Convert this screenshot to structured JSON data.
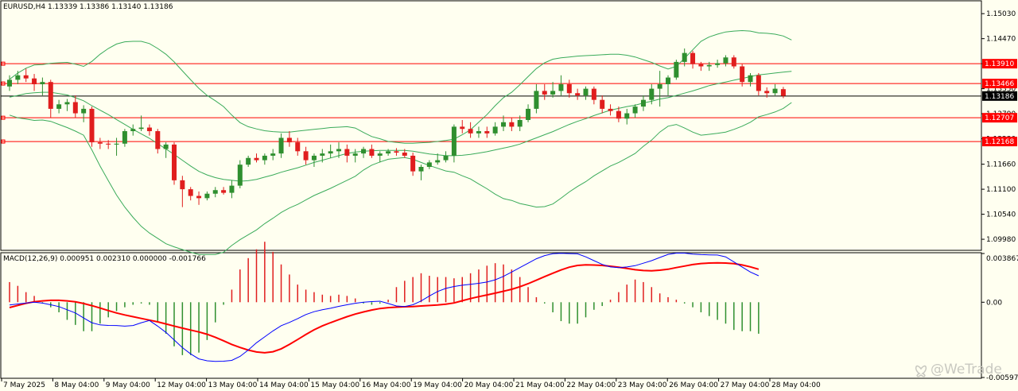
{
  "chart_data": {
    "type": "candlestick",
    "symbol_header": "EURUSD,H4  1.13339 1.13386 1.13140 1.13186",
    "price_axis": {
      "ylim": [
        1.0975,
        1.153
      ],
      "ticks": [
        "1.15030",
        "1.14470",
        "1.13910",
        "1.13350",
        "1.12790",
        "1.12230",
        "1.11660",
        "1.11100",
        "1.10540",
        "1.09980"
      ]
    },
    "horizontal_lines": [
      {
        "value": 1.1391,
        "label": "1.13910",
        "color": "#ff0000"
      },
      {
        "value": 1.13466,
        "label": "1.13466",
        "color": "#ff0000"
      },
      {
        "value": 1.127,
        "label": "1.12707",
        "color": "#ff0000"
      },
      {
        "value": 1.12168,
        "label": "1.12168",
        "color": "#ff0000"
      },
      {
        "value": 1.13186,
        "label": "1.13186",
        "color": "#000000"
      }
    ],
    "time_axis_labels": [
      "7 May 2025",
      "8 May 04:00",
      "9 May 04:00",
      "12 May 04:00",
      "13 May 04:00",
      "14 May 04:00",
      "15 May 04:00",
      "16 May 04:00",
      "19 May 04:00",
      "20 May 04:00",
      "21 May 04:00",
      "22 May 04:00",
      "23 May 04:00",
      "26 May 04:00",
      "27 May 04:00",
      "28 May 04:00"
    ],
    "candles": [
      [
        1.134,
        1.1365,
        1.133,
        1.1355
      ],
      [
        1.1355,
        1.1375,
        1.1345,
        1.1365
      ],
      [
        1.1365,
        1.138,
        1.135,
        1.1358
      ],
      [
        1.1358,
        1.1368,
        1.133,
        1.1345
      ],
      [
        1.1345,
        1.136,
        1.132,
        1.135
      ],
      [
        1.135,
        1.1355,
        1.127,
        1.129
      ],
      [
        1.129,
        1.131,
        1.128,
        1.13
      ],
      [
        1.13,
        1.1312,
        1.1285,
        1.1305
      ],
      [
        1.1305,
        1.132,
        1.127,
        1.128
      ],
      [
        1.128,
        1.1298,
        1.126,
        1.129
      ],
      [
        1.129,
        1.1295,
        1.1205,
        1.1215
      ],
      [
        1.1215,
        1.1225,
        1.12,
        1.1212
      ],
      [
        1.1212,
        1.122,
        1.12,
        1.121
      ],
      [
        1.121,
        1.1225,
        1.1185,
        1.1212
      ],
      [
        1.1212,
        1.1245,
        1.1205,
        1.124
      ],
      [
        1.124,
        1.1255,
        1.123,
        1.1245
      ],
      [
        1.1245,
        1.1275,
        1.124,
        1.1248
      ],
      [
        1.1248,
        1.1255,
        1.123,
        1.124
      ],
      [
        1.124,
        1.1245,
        1.119,
        1.12
      ],
      [
        1.12,
        1.1215,
        1.118,
        1.121
      ],
      [
        1.121,
        1.1215,
        1.112,
        1.113
      ],
      [
        1.113,
        1.114,
        1.107,
        1.111
      ],
      [
        1.111,
        1.1115,
        1.1085,
        1.1095
      ],
      [
        1.1095,
        1.1105,
        1.1075,
        1.109
      ],
      [
        1.109,
        1.1105,
        1.1085,
        1.11
      ],
      [
        1.11,
        1.1115,
        1.1092,
        1.1108
      ],
      [
        1.1108,
        1.1115,
        1.1098,
        1.1102
      ],
      [
        1.1102,
        1.113,
        1.109,
        1.1118
      ],
      [
        1.1118,
        1.1175,
        1.1112,
        1.1165
      ],
      [
        1.1165,
        1.1185,
        1.116,
        1.118
      ],
      [
        1.118,
        1.119,
        1.117,
        1.1175
      ],
      [
        1.1175,
        1.119,
        1.1165,
        1.1185
      ],
      [
        1.1185,
        1.12,
        1.1175,
        1.119
      ],
      [
        1.119,
        1.1235,
        1.118,
        1.1225
      ],
      [
        1.1225,
        1.124,
        1.1205,
        1.1215
      ],
      [
        1.1215,
        1.1225,
        1.1185,
        1.1195
      ],
      [
        1.1195,
        1.1205,
        1.1165,
        1.1175
      ],
      [
        1.1175,
        1.119,
        1.116,
        1.1185
      ],
      [
        1.1185,
        1.12,
        1.117,
        1.119
      ],
      [
        1.119,
        1.121,
        1.118,
        1.1195
      ],
      [
        1.1195,
        1.1215,
        1.118,
        1.12
      ],
      [
        1.12,
        1.121,
        1.117,
        1.1185
      ],
      [
        1.1185,
        1.12,
        1.117,
        1.119
      ],
      [
        1.119,
        1.1205,
        1.118,
        1.12
      ],
      [
        1.12,
        1.121,
        1.118,
        1.1185
      ],
      [
        1.1185,
        1.1195,
        1.117,
        1.119
      ],
      [
        1.119,
        1.12,
        1.1185,
        1.1195
      ],
      [
        1.1195,
        1.1202,
        1.1185,
        1.1192
      ],
      [
        1.1192,
        1.12,
        1.118,
        1.1185
      ],
      [
        1.1185,
        1.1192,
        1.114,
        1.115
      ],
      [
        1.115,
        1.1165,
        1.113,
        1.116
      ],
      [
        1.116,
        1.1175,
        1.1155,
        1.117
      ],
      [
        1.117,
        1.119,
        1.1165,
        1.1175
      ],
      [
        1.1175,
        1.1195,
        1.117,
        1.1185
      ],
      [
        1.1185,
        1.1255,
        1.117,
        1.125
      ],
      [
        1.125,
        1.1265,
        1.1235,
        1.1245
      ],
      [
        1.1245,
        1.126,
        1.1225,
        1.1235
      ],
      [
        1.1235,
        1.125,
        1.1225,
        1.124
      ],
      [
        1.124,
        1.125,
        1.1225,
        1.1235
      ],
      [
        1.1235,
        1.126,
        1.123,
        1.125
      ],
      [
        1.125,
        1.1275,
        1.124,
        1.126
      ],
      [
        1.126,
        1.127,
        1.124,
        1.125
      ],
      [
        1.125,
        1.1275,
        1.124,
        1.1265
      ],
      [
        1.1265,
        1.13,
        1.126,
        1.129
      ],
      [
        1.129,
        1.1345,
        1.128,
        1.133
      ],
      [
        1.133,
        1.1345,
        1.131,
        1.1322
      ],
      [
        1.1322,
        1.135,
        1.1315,
        1.133
      ],
      [
        1.133,
        1.1365,
        1.132,
        1.1345
      ],
      [
        1.1345,
        1.1355,
        1.1315,
        1.1325
      ],
      [
        1.1325,
        1.1335,
        1.131,
        1.132
      ],
      [
        1.132,
        1.134,
        1.131,
        1.1335
      ],
      [
        1.1335,
        1.134,
        1.13,
        1.131
      ],
      [
        1.131,
        1.132,
        1.128,
        1.129
      ],
      [
        1.129,
        1.13,
        1.1275,
        1.1285
      ],
      [
        1.1285,
        1.1295,
        1.126,
        1.1268
      ],
      [
        1.1268,
        1.129,
        1.1255,
        1.128
      ],
      [
        1.128,
        1.13,
        1.127,
        1.1295
      ],
      [
        1.1295,
        1.132,
        1.1285,
        1.131
      ],
      [
        1.131,
        1.1345,
        1.13,
        1.1335
      ],
      [
        1.1335,
        1.1375,
        1.1295,
        1.1345
      ],
      [
        1.1345,
        1.1365,
        1.132,
        1.136
      ],
      [
        1.136,
        1.14,
        1.1355,
        1.1395
      ],
      [
        1.1395,
        1.1425,
        1.1385,
        1.1415
      ],
      [
        1.1415,
        1.142,
        1.138,
        1.139
      ],
      [
        1.139,
        1.1395,
        1.1375,
        1.1385
      ],
      [
        1.1385,
        1.1395,
        1.1375,
        1.1388
      ],
      [
        1.1388,
        1.14,
        1.1382,
        1.1392
      ],
      [
        1.1392,
        1.141,
        1.1385,
        1.1405
      ],
      [
        1.1405,
        1.141,
        1.138,
        1.1385
      ],
      [
        1.1385,
        1.139,
        1.134,
        1.135
      ],
      [
        1.135,
        1.137,
        1.134,
        1.1365
      ],
      [
        1.1365,
        1.137,
        1.132,
        1.133
      ],
      [
        1.133,
        1.1338,
        1.1315,
        1.1325
      ],
      [
        1.1325,
        1.1345,
        1.132,
        1.1335
      ],
      [
        1.1334,
        1.1339,
        1.1314,
        1.1319
      ]
    ],
    "bollinger": {
      "upper": [
        1.1356,
        1.137,
        1.1381,
        1.1388,
        1.1389,
        1.1392,
        1.1393,
        1.1394,
        1.139,
        1.1385,
        1.1396,
        1.1412,
        1.1425,
        1.1435,
        1.144,
        1.1441,
        1.1441,
        1.1436,
        1.1425,
        1.1412,
        1.1395,
        1.1375,
        1.1355,
        1.1336,
        1.132,
        1.1308,
        1.1295,
        1.1276,
        1.1259,
        1.125,
        1.1245,
        1.1241,
        1.1239,
        1.1238,
        1.1238,
        1.124,
        1.1242,
        1.1244,
        1.1246,
        1.1248,
        1.1249,
        1.125,
        1.1247,
        1.1237,
        1.1228,
        1.1223,
        1.1217,
        1.1215,
        1.1213,
        1.1213,
        1.1214,
        1.1215,
        1.1217,
        1.1219,
        1.1222,
        1.1232,
        1.1243,
        1.126,
        1.1277,
        1.1297,
        1.1315,
        1.1327,
        1.1344,
        1.1362,
        1.138,
        1.1393,
        1.1401,
        1.1404,
        1.1406,
        1.1408,
        1.1409,
        1.141,
        1.1411,
        1.1412,
        1.1412,
        1.141,
        1.1406,
        1.14,
        1.1394,
        1.1386,
        1.1379,
        1.1385,
        1.1403,
        1.1422,
        1.1441,
        1.1451,
        1.1457,
        1.1462,
        1.1464,
        1.1465,
        1.1464,
        1.146,
        1.1459,
        1.1457,
        1.1453,
        1.1444
      ],
      "mid": [
        1.1316,
        1.132,
        1.1324,
        1.1326,
        1.1327,
        1.1327,
        1.1324,
        1.1321,
        1.1315,
        1.1308,
        1.1297,
        1.1287,
        1.1277,
        1.1266,
        1.1255,
        1.1244,
        1.1234,
        1.1224,
        1.1212,
        1.12,
        1.1188,
        1.1175,
        1.1162,
        1.115,
        1.1142,
        1.1136,
        1.1132,
        1.113,
        1.1128,
        1.1129,
        1.1132,
        1.1137,
        1.1142,
        1.1148,
        1.1153,
        1.1158,
        1.1164,
        1.117,
        1.1175,
        1.118,
        1.1185,
        1.119,
        1.1193,
        1.1195,
        1.1196,
        1.1197,
        1.1197,
        1.1197,
        1.1197,
        1.1195,
        1.1192,
        1.1189,
        1.1187,
        1.1185,
        1.1185,
        1.1186,
        1.1188,
        1.1191,
        1.1194,
        1.1198,
        1.1202,
        1.1206,
        1.1211,
        1.1218,
        1.1225,
        1.1232,
        1.1239,
        1.1247,
        1.1255,
        1.1262,
        1.1268,
        1.1275,
        1.1281,
        1.1287,
        1.1291,
        1.1295,
        1.1298,
        1.1303,
        1.1307,
        1.1312,
        1.1315,
        1.132,
        1.1325,
        1.133,
        1.1336,
        1.1342,
        1.1346,
        1.135,
        1.1354,
        1.1358,
        1.1362,
        1.1366,
        1.1368,
        1.137,
        1.1372,
        1.1374
      ],
      "lower": [
        1.1276,
        1.127,
        1.1267,
        1.1264,
        1.1265,
        1.1262,
        1.1255,
        1.1248,
        1.124,
        1.1231,
        1.1198,
        1.1162,
        1.1129,
        1.1097,
        1.107,
        1.1047,
        1.1027,
        1.1012,
        1.1,
        1.0988,
        1.0981,
        1.0975,
        1.0969,
        1.0964,
        1.0964,
        1.0964,
        1.0969,
        1.0984,
        1.0997,
        1.1008,
        1.1019,
        1.1033,
        1.1045,
        1.1058,
        1.1068,
        1.1076,
        1.1086,
        1.1096,
        1.1104,
        1.1112,
        1.1121,
        1.113,
        1.1139,
        1.1153,
        1.1164,
        1.1171,
        1.1177,
        1.1179,
        1.1181,
        1.1177,
        1.117,
        1.1163,
        1.1157,
        1.1151,
        1.1148,
        1.114,
        1.1133,
        1.1122,
        1.1111,
        1.1099,
        1.1089,
        1.1085,
        1.1078,
        1.1074,
        1.107,
        1.1071,
        1.1077,
        1.109,
        1.1104,
        1.1116,
        1.1127,
        1.114,
        1.1151,
        1.1162,
        1.117,
        1.118,
        1.119,
        1.1206,
        1.122,
        1.1238,
        1.1251,
        1.1255,
        1.1247,
        1.1238,
        1.1231,
        1.1233,
        1.1235,
        1.1238,
        1.1244,
        1.1251,
        1.126,
        1.1272,
        1.1277,
        1.1283,
        1.1291,
        1.1304
      ]
    },
    "macd": {
      "header": "MACD(12,26,9) 0.000951 0.002310 0.000000 -0.001766",
      "ylim": [
        -0.005975,
        0.003867
      ],
      "ticks": [
        "0.003867",
        "0.00",
        "-0.005975"
      ],
      "macd_color": "#ff0000",
      "signal_color": "#0000ff",
      "main": [
        -0.00042,
        -0.00025,
        -9e-05,
        4e-05,
        0.00011,
        0.00015,
        0.00015,
        0.00011,
        3e-05,
        -0.0001,
        -0.00027,
        -0.00046,
        -0.00066,
        -0.00085,
        -0.00101,
        -0.00115,
        -0.00129,
        -0.00142,
        -0.00156,
        -0.00172,
        -0.00189,
        -0.00206,
        -0.00221,
        -0.00236,
        -0.00254,
        -0.00278,
        -0.00306,
        -0.00335,
        -0.00359,
        -0.0038,
        -0.00395,
        -0.00401,
        -0.00393,
        -0.0037,
        -0.00335,
        -0.00296,
        -0.00256,
        -0.00219,
        -0.00188,
        -0.00162,
        -0.00138,
        -0.00115,
        -0.00094,
        -0.00077,
        -0.00062,
        -0.0005,
        -0.00043,
        -0.00039,
        -0.00036,
        -0.00034,
        -0.0003,
        -0.00026,
        -0.00022,
        -0.00016,
        -6e-05,
        0.00012,
        0.00029,
        0.00044,
        0.00058,
        0.00072,
        0.00087,
        0.00103,
        0.00123,
        0.00147,
        0.00175,
        0.00203,
        0.0023,
        0.00256,
        0.00278,
        0.00292,
        0.00297,
        0.00295,
        0.00292,
        0.00286,
        0.00278,
        0.00268,
        0.00258,
        0.00252,
        0.0025,
        0.00254,
        0.00262,
        0.00275,
        0.00287,
        0.00299,
        0.00307,
        0.00311,
        0.00312,
        0.00311,
        0.00306,
        0.00296,
        0.00281,
        0.00262
      ],
      "signal": [
        -0.00022,
        -0.00014,
        -6e-05,
        0.0,
        -7e-05,
        -0.0002,
        -0.00035,
        -0.0006,
        -0.00085,
        -0.00125,
        -0.00163,
        -0.0018,
        -0.00184,
        -0.00185,
        -0.0019,
        -0.00185,
        -0.00163,
        -0.00145,
        -0.0019,
        -0.0024,
        -0.003,
        -0.0036,
        -0.0041,
        -0.0045,
        -0.00465,
        -0.0047,
        -0.00468,
        -0.00462,
        -0.0043,
        -0.0038,
        -0.00322,
        -0.00275,
        -0.00228,
        -0.00186,
        -0.0016,
        -0.0013,
        -0.00098,
        -0.00075,
        -0.0006,
        -0.00048,
        -0.00033,
        -0.0002,
        -8e-05,
        0.0,
        5e-05,
        8e-05,
        -0.0001,
        -0.0003,
        -0.00035,
        -0.0002,
        0.0001,
        0.0005,
        0.00085,
        0.0011,
        0.00125,
        0.00135,
        0.00142,
        0.0015,
        0.0016,
        0.00178,
        0.00205,
        0.0024,
        0.00275,
        0.0031,
        0.00345,
        0.0037,
        0.00385,
        0.00388,
        0.00386,
        0.00384,
        0.0036,
        0.0033,
        0.003,
        0.0028,
        0.00275,
        0.0028,
        0.0029,
        0.0031,
        0.0033,
        0.00355,
        0.0038,
        0.0039,
        0.0039,
        0.00382,
        0.00378,
        0.00376,
        0.00375,
        0.0036,
        0.0032,
        0.0028,
        0.0024,
        0.0021
      ],
      "histogram": [
        0.0016,
        0.0013,
        0.0008,
        0.0005,
        -0.0001,
        -0.0004,
        -0.0008,
        -0.0014,
        -0.0018,
        -0.0023,
        -0.0023,
        -0.0017,
        -0.0012,
        -0.0007,
        -0.0004,
        -0.0002,
        -0.0001,
        -0.0002,
        -0.0015,
        -0.0025,
        -0.0035,
        -0.0042,
        -0.0042,
        -0.004,
        -0.003,
        -0.0016,
        -0.0002,
        0.001,
        0.0026,
        0.0035,
        0.0042,
        0.0048,
        0.004,
        0.003,
        0.0022,
        0.0014,
        0.001,
        0.0008,
        0.0006,
        0.0005,
        0.0006,
        0.0005,
        0.0003,
        -0.0001,
        -0.0002,
        -0.0001,
        0.0002,
        0.0012,
        0.0017,
        0.002,
        0.0023,
        0.0021,
        0.002,
        0.002,
        0.0019,
        0.002,
        0.0023,
        0.0026,
        0.0029,
        0.0031,
        0.003,
        0.0026,
        0.002,
        0.0012,
        0.0004,
        -0.0001,
        -0.0008,
        -0.0015,
        -0.0017,
        -0.0017,
        -0.0012,
        -0.0006,
        -0.0003,
        0.0002,
        0.0008,
        0.0014,
        0.0018,
        0.0016,
        0.0012,
        0.0007,
        0.0004,
        0.0002,
        -0.0001,
        -0.0004,
        -0.0008,
        -0.0011,
        -0.0014,
        -0.0017,
        -0.0022,
        -0.0023,
        -0.0023,
        -0.0025
      ]
    },
    "colors": {
      "background": "#fffff0",
      "bull": "#2f8f2f",
      "bear": "#e01e1e",
      "bands": "#3aab5a",
      "bid_line": "#000000",
      "grid_frame": "#000000"
    },
    "watermark": "@WeTrade",
    "watermark_icon": "butterfly-icon"
  }
}
